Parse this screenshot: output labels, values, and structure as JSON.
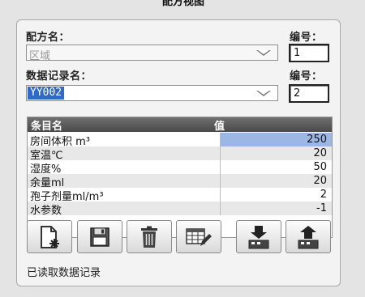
{
  "window": {
    "title": "配方视图"
  },
  "recipe": {
    "label": "配方名：",
    "value": "区域",
    "number_label": "编号：",
    "number_value": "1"
  },
  "record": {
    "label": "数据记录名：",
    "value": "YY002",
    "number_label": "编号：",
    "number_value": "2"
  },
  "table": {
    "headers": [
      "条目名",
      "值"
    ],
    "rows": [
      {
        "name": "房间体积  m³",
        "value": "250"
      },
      {
        "name": "室温℃",
        "value": "20"
      },
      {
        "name": "湿度%",
        "value": "50"
      },
      {
        "name": "余量ml",
        "value": "20"
      },
      {
        "name": "孢子剂量ml/m³",
        "value": "2"
      },
      {
        "name": "水参数",
        "value": "-1"
      }
    ]
  },
  "toolbar": {
    "icons": [
      "new-record-icon",
      "save-icon",
      "delete-icon",
      "edit-table-icon",
      "import-to-plc-icon",
      "export-from-plc-icon"
    ]
  },
  "status": {
    "text": "已读取数据记录"
  }
}
